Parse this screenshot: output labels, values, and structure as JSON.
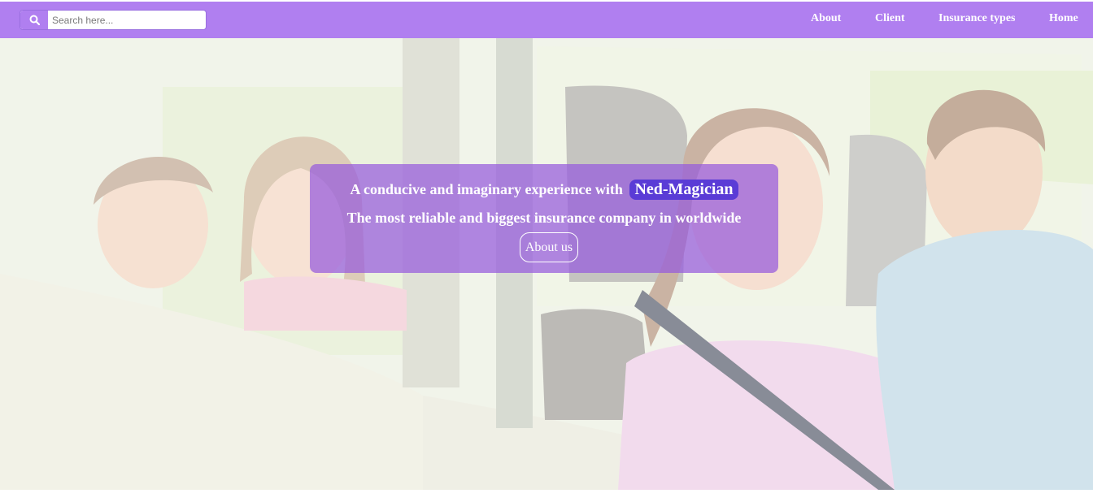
{
  "navbar": {
    "search": {
      "placeholder": "Search here...",
      "icon": "search-icon"
    },
    "links": [
      "About",
      "Client",
      "Insurance types",
      "Home"
    ]
  },
  "hero": {
    "headline_prefix": "A conducive and imaginary experience with",
    "brand": "Ned-Magician",
    "subheadline": "The most reliable and biggest insurance company in worldwide",
    "cta_label": "About us"
  },
  "colors": {
    "navbar": "#b07ff0",
    "overlay": "#965adc",
    "brand_badge": "#5a3cd6",
    "text": "#ffffff"
  }
}
